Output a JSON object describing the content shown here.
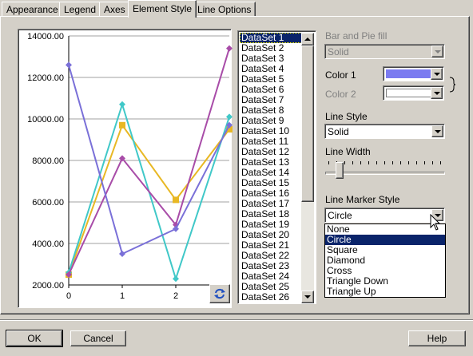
{
  "tabs": [
    "Appearance",
    "Legend",
    "Axes",
    "Element Style",
    "Line Options"
  ],
  "active_tab": "Element Style",
  "chart_data": {
    "type": "line",
    "x": [
      0,
      1,
      2,
      3
    ],
    "xticks": [
      "0",
      "1",
      "2"
    ],
    "yticks": [
      "14000.00",
      "12000.00",
      "10000.00",
      "8000.00",
      "6000.00",
      "4000.00",
      "2000.00"
    ],
    "ylim": [
      2000,
      14000
    ],
    "xlim": [
      0,
      3
    ],
    "grid": true,
    "series": [
      {
        "color": "#e8b824",
        "marker": "square",
        "values": [
          2500,
          9700,
          6100,
          9500
        ]
      },
      {
        "color": "#40c8c8",
        "marker": "diamond",
        "values": [
          2600,
          10700,
          2300,
          10100
        ]
      },
      {
        "color": "#a84ca8",
        "marker": "diamond",
        "values": [
          2500,
          8100,
          4900,
          13400
        ]
      },
      {
        "color": "#7a70d8",
        "marker": "diamond",
        "values": [
          12600,
          3500,
          4700,
          9700
        ]
      }
    ]
  },
  "datasets": {
    "items": [
      "DataSet 1",
      "DataSet 2",
      "DataSet 3",
      "DataSet 4",
      "DataSet 5",
      "DataSet 6",
      "DataSet 7",
      "DataSet 8",
      "DataSet 9",
      "DataSet 10",
      "DataSet 11",
      "DataSet 12",
      "DataSet 13",
      "DataSet 14",
      "DataSet 15",
      "DataSet 16",
      "DataSet 17",
      "DataSet 18",
      "DataSet 19",
      "DataSet 20",
      "DataSet 21",
      "DataSet 22",
      "DataSet 23",
      "DataSet 24",
      "DataSet 25",
      "DataSet 26"
    ],
    "selected": "DataSet 1"
  },
  "options": {
    "bar_pie_fill_label": "Bar and Pie fill",
    "bar_pie_fill_value": "Solid",
    "color1_label": "Color 1",
    "color1_value": "#7b7bf0",
    "color2_label": "Color 2",
    "color2_value": "#ffffff",
    "line_style_label": "Line Style",
    "line_style_value": "Solid",
    "line_width_label": "Line Width",
    "line_width_value_fraction": 0.1,
    "marker_style_label": "Line Marker Style",
    "marker_style_value": "Circle",
    "marker_options": [
      "None",
      "Circle",
      "Square",
      "Diamond",
      "Cross",
      "Triangle Down",
      "Triangle Up"
    ],
    "marker_selected": "Circle"
  },
  "buttons": {
    "ok": "OK",
    "cancel": "Cancel",
    "help": "Help"
  },
  "icons": {
    "refresh": "refresh-icon",
    "dropdown": "chevron-down-icon",
    "scroll_up": "scroll-up-icon",
    "scroll_down": "scroll-down-icon",
    "cursor": "mouse-cursor-icon"
  }
}
